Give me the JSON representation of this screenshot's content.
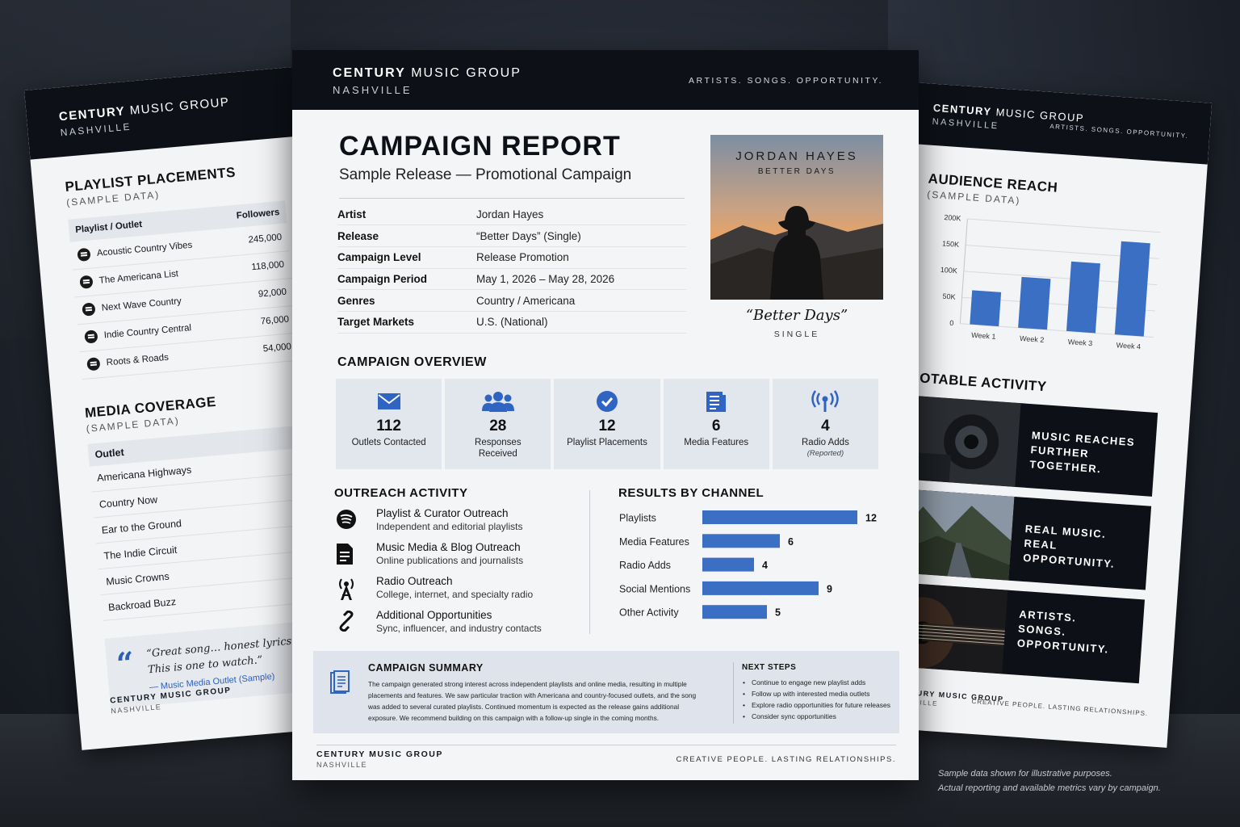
{
  "brand": {
    "name_bold": "CENTURY",
    "name_rest": " MUSIC GROUP",
    "city": "NASHVILLE",
    "tagline": "ARTISTS. SONGS. OPPORTUNITY."
  },
  "left_page": {
    "playlist": {
      "title": "PLAYLIST PLACEMENTS",
      "subtitle": "(SAMPLE DATA)",
      "col_outlet": "Playlist / Outlet",
      "col_followers": "Followers",
      "rows": [
        {
          "name": "Acoustic Country Vibes",
          "followers": "245,000"
        },
        {
          "name": "The Americana List",
          "followers": "118,000"
        },
        {
          "name": "Next Wave Country",
          "followers": "92,000"
        },
        {
          "name": "Indie Country Central",
          "followers": "76,000"
        },
        {
          "name": "Roots & Roads",
          "followers": "54,000"
        }
      ]
    },
    "media": {
      "title": "MEDIA COVERAGE",
      "subtitle": "(SAMPLE DATA)",
      "col_outlet": "Outlet",
      "rows": [
        "Americana Highways",
        "Country Now",
        "Ear to the Ground",
        "The Indie Circuit",
        "Music Crowns",
        "Backroad Buzz"
      ]
    },
    "quote": {
      "mark": "“",
      "line1": "“Great song… honest lyrics",
      "line2": "This is one to watch.”",
      "source": "— Music Media Outlet (Sample)"
    },
    "footer": {
      "brand": "CENTURY MUSIC GROUP",
      "city": "NASHVILLE"
    }
  },
  "right_page": {
    "reach": {
      "title": "AUDIENCE REACH",
      "subtitle": "(SAMPLE DATA)"
    },
    "notable": {
      "title": "NOTABLE ACTIVITY",
      "items": [
        {
          "line1": "MUSIC REACHES",
          "line2": "FURTHER TOGETHER.",
          "line3": ""
        },
        {
          "line1": "REAL MUSIC.",
          "line2": "REAL OPPORTUNITY.",
          "line3": ""
        },
        {
          "line1": "ARTISTS.",
          "line2": "SONGS.",
          "line3": "OPPORTUNITY."
        }
      ]
    },
    "footer": {
      "brand": "CENTURY MUSIC GROUP",
      "city": "NASHVILLE",
      "tagline": "CREATIVE PEOPLE. LASTING RELATIONSHIPS."
    }
  },
  "chart_data": [
    {
      "type": "bar",
      "categories": [
        "Week 1",
        "Week 2",
        "Week 3",
        "Week 4"
      ],
      "values": [
        65000,
        97000,
        133000,
        178000
      ],
      "ylim": [
        0,
        200000
      ],
      "yticks": [
        "0",
        "50K",
        "100K",
        "150K",
        "200K"
      ],
      "grid": true,
      "color": "#3a6fc4"
    },
    {
      "type": "bar",
      "orientation": "horizontal",
      "title": "RESULTS BY CHANNEL",
      "categories": [
        "Playlists",
        "Media Features",
        "Radio Adds",
        "Social Mentions",
        "Other Activity"
      ],
      "values": [
        12,
        6,
        4,
        9,
        5
      ],
      "xlim": [
        0,
        12
      ],
      "color": "#3a6fc4"
    }
  ],
  "center": {
    "title": "CAMPAIGN REPORT",
    "subtitle": "Sample Release — Promotional Campaign",
    "details": [
      {
        "k": "Artist",
        "v": "Jordan Hayes"
      },
      {
        "k": "Release",
        "v": "“Better Days” (Single)"
      },
      {
        "k": "Campaign Level",
        "v": "Release Promotion"
      },
      {
        "k": "Campaign Period",
        "v": "May 1, 2026 – May 28, 2026"
      },
      {
        "k": "Genres",
        "v": "Country / Americana"
      },
      {
        "k": "Target Markets",
        "v": "U.S. (National)"
      }
    ],
    "cover": {
      "artist": "JORDAN HAYES",
      "song": "BETTER DAYS",
      "caption": "“Better Days”",
      "type": "SINGLE"
    },
    "overview": {
      "title": "CAMPAIGN OVERVIEW",
      "kpis": [
        {
          "icon": "envelope-icon",
          "value": "112",
          "label": "Outlets Contacted",
          "note": ""
        },
        {
          "icon": "people-icon",
          "value": "28",
          "label": "Responses",
          "label2": "Received",
          "note": ""
        },
        {
          "icon": "check-circle-icon",
          "value": "12",
          "label": "Playlist Placements",
          "note": ""
        },
        {
          "icon": "document-icon",
          "value": "6",
          "label": "Media Features",
          "note": ""
        },
        {
          "icon": "broadcast-icon",
          "value": "4",
          "label": "Radio Adds",
          "note": "(Reported)"
        }
      ]
    },
    "outreach": {
      "title": "OUTREACH ACTIVITY",
      "items": [
        {
          "icon": "streaming-icon",
          "title": "Playlist & Curator Outreach",
          "desc": "Independent and editorial playlists"
        },
        {
          "icon": "document-icon",
          "title": "Music Media & Blog Outreach",
          "desc": "Online publications and journalists"
        },
        {
          "icon": "radio-tower-icon",
          "title": "Radio Outreach",
          "desc": "College, internet, and specialty radio"
        },
        {
          "icon": "link-icon",
          "title": "Additional Opportunities",
          "desc": "Sync, influencer, and industry contacts"
        }
      ]
    },
    "summary": {
      "title": "CAMPAIGN SUMMARY",
      "lines": [
        "The campaign generated strong interest across independent playlists and online media, resulting in multiple",
        "placements and features. We saw particular traction with Americana and country-focused outlets, and the song",
        "was added to several curated playlists. Continued momentum is expected as the release gains additional",
        "exposure. We recommend building on this campaign with a follow-up single in the coming months."
      ],
      "next_title": "NEXT STEPS",
      "next_steps": [
        "Continue to engage new playlist adds",
        "Follow up with interested media outlets",
        "Explore radio opportunities for future releases",
        "Consider sync opportunities"
      ]
    },
    "footer": {
      "brand": "CENTURY MUSIC GROUP",
      "city": "NASHVILLE",
      "tagline": "CREATIVE PEOPLE. LASTING RELATIONSHIPS."
    }
  },
  "disclaimer": {
    "line1": "Sample data shown for illustrative purposes.",
    "line2": "Actual reporting and available metrics vary by campaign."
  }
}
